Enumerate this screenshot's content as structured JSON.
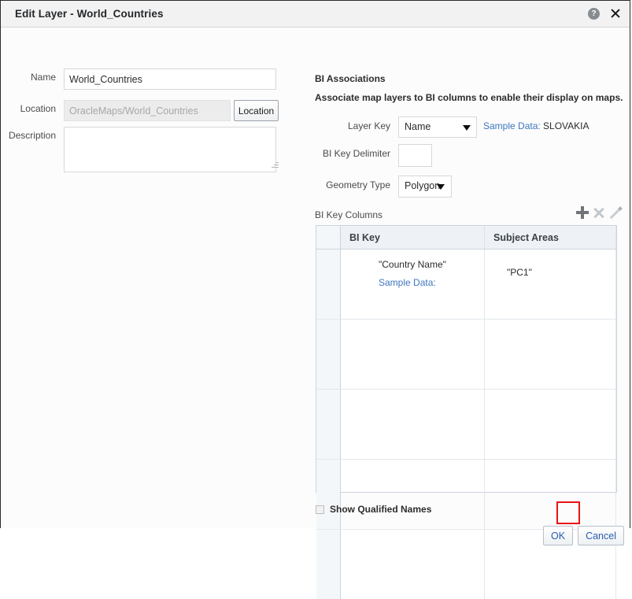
{
  "window": {
    "title": "Edit Layer - World_Countries",
    "help_icon": "help-icon",
    "help_glyph": "?",
    "close_icon": "close-icon"
  },
  "form": {
    "name_label": "Name",
    "name_value": "World_Countries",
    "location_label": "Location",
    "location_value": "OracleMaps/World_Countries",
    "location_button": "Location",
    "description_label": "Description",
    "description_value": ""
  },
  "bi_associations": {
    "section_title": "BI Associations",
    "section_description": "Associate map layers to BI columns to enable their display on maps.",
    "layer_key_label": "Layer Key",
    "layer_key_value": "Name",
    "sample_data_link": "Sample Data:",
    "sample_data_value": "SLOVAKIA",
    "bi_key_delimiter_label": "BI Key Delimiter",
    "bi_key_delimiter_value": "",
    "geometry_type_label": "Geometry Type",
    "geometry_type_value": "Polygon"
  },
  "bi_key_columns": {
    "label": "BI Key Columns",
    "tools": [
      {
        "name": "add-icon",
        "title": "Add"
      },
      {
        "name": "delete-icon",
        "title": "Delete"
      },
      {
        "name": "edit-pencil-icon",
        "title": "Edit"
      }
    ],
    "columns": [
      "",
      "BI Key",
      "Subject Areas"
    ],
    "rows": [
      {
        "bi_key": "\"Country Name\"",
        "bi_key_link": "Sample Data:",
        "subject_areas": "\"PC1\""
      },
      {
        "bi_key": "",
        "bi_key_link": "",
        "subject_areas": ""
      },
      {
        "bi_key": "",
        "bi_key_link": "",
        "subject_areas": ""
      },
      {
        "bi_key": "",
        "bi_key_link": "",
        "subject_areas": ""
      },
      {
        "bi_key": "",
        "bi_key_link": "",
        "subject_areas": ""
      }
    ]
  },
  "footer": {
    "show_qualified_names_label": "Show Qualified Names",
    "show_qualified_names_checked": false,
    "ok_label": "OK",
    "cancel_label": "Cancel"
  },
  "colors": {
    "link": "#3f76bf",
    "button_text": "#2a5db0",
    "highlight": "#e81313",
    "titlebar_bg": "#f2f2f2",
    "grid_header_bg": "#eef2f6"
  }
}
